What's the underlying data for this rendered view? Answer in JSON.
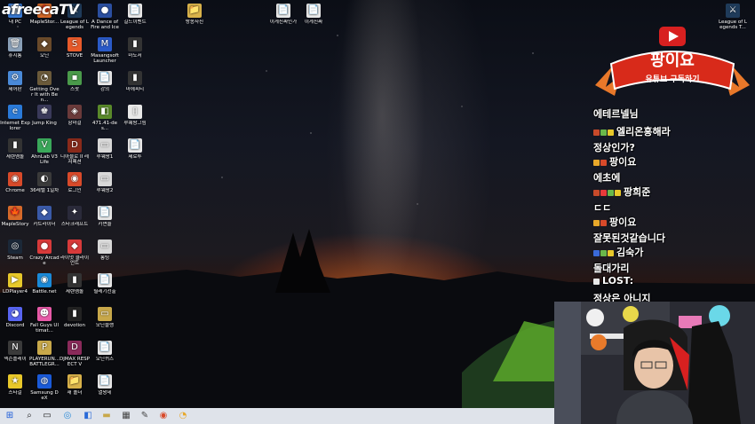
{
  "overlay": {
    "logo": "afreecaTV"
  },
  "desktop": {
    "icons": [
      {
        "label": "내 PC",
        "symbol": "🖥",
        "color": "#3b7dd8"
      },
      {
        "label": "MapleStor...",
        "symbol": "🍁",
        "color": "#d86a2a"
      },
      {
        "label": "League of Legends",
        "symbol": "⚔",
        "color": "#1f3b5a"
      },
      {
        "label": "A Dance of Fire and Ice",
        "symbol": "●",
        "color": "#2b4fa0"
      },
      {
        "label": "길드이벤트",
        "symbol": "📄",
        "color": "#e8e8e8"
      },
      {
        "label": "방송사진",
        "symbol": "📁",
        "color": "#d9b24a"
      },
      {
        "label": "이게진짜인가",
        "symbol": "📄",
        "color": "#e8e8e8"
      },
      {
        "label": "이게진짜",
        "symbol": "📄",
        "color": "#e8e8e8"
      },
      {
        "label": "League of Legends T...",
        "symbol": "⚔",
        "color": "#1f3b5a"
      },
      {
        "label": "휴지통",
        "symbol": "🗑",
        "color": "#8aa0b8"
      },
      {
        "label": "오딘",
        "symbol": "◆",
        "color": "#6a4a2a"
      },
      {
        "label": "STOVE",
        "symbol": "S",
        "color": "#e85a2a"
      },
      {
        "label": "Masangsoft Launcher",
        "symbol": "M",
        "color": "#2a5ac8"
      },
      {
        "label": "마도서",
        "symbol": "▮",
        "color": "#333"
      },
      {
        "label": "제어판",
        "symbol": "⚙",
        "color": "#4a8ad8"
      },
      {
        "label": "Getting Over It with Ben...",
        "symbol": "◔",
        "color": "#6b5a3a"
      },
      {
        "label": "스팟",
        "symbol": "▪",
        "color": "#4a9a4a"
      },
      {
        "label": "강의",
        "symbol": "📄",
        "color": "#e8e8e8"
      },
      {
        "label": "마에피티",
        "symbol": "▮",
        "color": "#333"
      },
      {
        "label": "Internet Explorer",
        "symbol": "e",
        "color": "#2a7ad8"
      },
      {
        "label": "Jump King",
        "symbol": "♚",
        "color": "#3a3a5a"
      },
      {
        "label": "항마걸",
        "symbol": "◈",
        "color": "#6a3a3a"
      },
      {
        "label": "471.41-des...",
        "symbol": "◧",
        "color": "#5a8a2a"
      },
      {
        "label": "루웨팡그림",
        "symbol": "▯",
        "color": "#e8e8e8"
      },
      {
        "label": "세렌멤돌",
        "symbol": "▮",
        "color": "#333"
      },
      {
        "label": "AhnLab V3 Life",
        "symbol": "V",
        "color": "#3aa85a"
      },
      {
        "label": "디아블로 II 레저렉션",
        "symbol": "D",
        "color": "#8a2a1a"
      },
      {
        "label": "루웨팡1",
        "symbol": "▭",
        "color": "#d8d8d8"
      },
      {
        "label": "제로투",
        "symbol": "📄",
        "color": "#e8e8e8"
      },
      {
        "label": "Chrome",
        "symbol": "◉",
        "color": "#d84a2a"
      },
      {
        "label": "36레밸 1일차",
        "symbol": "◐",
        "color": "#3a3a3a"
      },
      {
        "label": "로그인",
        "symbol": "◉",
        "color": "#d84a2a"
      },
      {
        "label": "루웨팡2",
        "symbol": "▭",
        "color": "#d8d8d8"
      },
      {
        "label": "MapleStory",
        "symbol": "🍁",
        "color": "#d86a2a"
      },
      {
        "label": "카트라이더",
        "symbol": "◆",
        "color": "#3a5aa8"
      },
      {
        "label": "스타크래프트",
        "symbol": "✦",
        "color": "#2a2a3a"
      },
      {
        "label": "카면술",
        "symbol": "📄",
        "color": "#e8e8e8"
      },
      {
        "label": "Steam",
        "symbol": "◎",
        "color": "#1b2838"
      },
      {
        "label": "Crazy Arcade",
        "symbol": "●",
        "color": "#d83a3a"
      },
      {
        "label": "라이엇 클라이언트",
        "symbol": "◆",
        "color": "#d83a3a"
      },
      {
        "label": "롱팅",
        "symbol": "▭",
        "color": "#d8d8d8"
      },
      {
        "label": "LDPlayer4",
        "symbol": "▶",
        "color": "#e8c82a"
      },
      {
        "label": "Battle.net",
        "symbol": "◉",
        "color": "#1a8ad8"
      },
      {
        "label": "세렌멤돌",
        "symbol": "▮",
        "color": "#333"
      },
      {
        "label": "릴레기선출",
        "symbol": "📄",
        "color": "#e8e8e8"
      },
      {
        "label": "Discord",
        "symbol": "◕",
        "color": "#5865f2"
      },
      {
        "label": "Fall Guys Ultimat...",
        "symbol": "☻",
        "color": "#e85aa8"
      },
      {
        "label": "devotion",
        "symbol": "▮",
        "color": "#222"
      },
      {
        "label": "모딘블랭",
        "symbol": "▭",
        "color": "#c8a84a"
      },
      {
        "label": "넥슨플레이",
        "symbol": "N",
        "color": "#3a3a3a"
      },
      {
        "label": "PLAYERUN... BATTLEGR...",
        "symbol": "P",
        "color": "#c8a84a"
      },
      {
        "label": "DJMAX RESPECT V",
        "symbol": "D",
        "color": "#8a2a5a"
      },
      {
        "label": "오딘퀴즈",
        "symbol": "📄",
        "color": "#e8e8e8"
      },
      {
        "label": "스타걸",
        "symbol": "★",
        "color": "#e8c82a"
      },
      {
        "label": "Samsung DeX",
        "symbol": "◍",
        "color": "#1a5ad8"
      },
      {
        "label": "새 폴더",
        "symbol": "📁",
        "color": "#d9b24a"
      },
      {
        "label": "열왕네",
        "symbol": "📄",
        "color": "#e8e8e8"
      }
    ]
  },
  "banner": {
    "title": "팡이요",
    "subtitle": "유튜브 구독하기"
  },
  "chat": [
    {
      "user": "에테르넬님",
      "message": "",
      "badges": []
    },
    {
      "user": "엘리온흥해라",
      "message": "정상인가?",
      "badges": [
        "#c84a2a",
        "#6ab84a",
        "#e8c82a"
      ]
    },
    {
      "user": "팡이요",
      "message": "에초에",
      "badges": [
        "#e8a82a",
        "#d84a2a"
      ]
    },
    {
      "user": "팡희준",
      "message": "ㄷㄷ",
      "badges": [
        "#c84a2a",
        "#e83a3a",
        "#6ab84a",
        "#e8c82a"
      ]
    },
    {
      "user": "팡이요",
      "message": "잘못된것같습니다",
      "badges": [
        "#e8a82a",
        "#d84a2a"
      ]
    },
    {
      "user": "김숙가",
      "message": "돌대가리",
      "badges": [
        "#3a6ad8",
        "#6ab84a",
        "#e8c82a"
      ]
    },
    {
      "user": "LOST:",
      "message": "정상은 아니지",
      "badges": [
        "#e8e8e8"
      ]
    }
  ],
  "taskbar": [
    {
      "name": "start-icon",
      "symbol": "⊞",
      "color": "#1a5ad8"
    },
    {
      "name": "search-icon",
      "symbol": "⌕",
      "color": "#222"
    },
    {
      "name": "task-view-icon",
      "symbol": "▭",
      "color": "#222"
    },
    {
      "name": "edge-icon",
      "symbol": "◎",
      "color": "#2a8ad8"
    },
    {
      "name": "photos-icon",
      "symbol": "◧",
      "color": "#2a6ad8"
    },
    {
      "name": "explorer-icon",
      "symbol": "▬",
      "color": "#c8a84a"
    },
    {
      "name": "calculator-icon",
      "symbol": "▦",
      "color": "#444"
    },
    {
      "name": "pen-icon",
      "symbol": "✎",
      "color": "#444"
    },
    {
      "name": "chrome-icon",
      "symbol": "◉",
      "color": "#d84a2a"
    },
    {
      "name": "app-icon",
      "symbol": "◔",
      "color": "#e8a82a"
    }
  ]
}
